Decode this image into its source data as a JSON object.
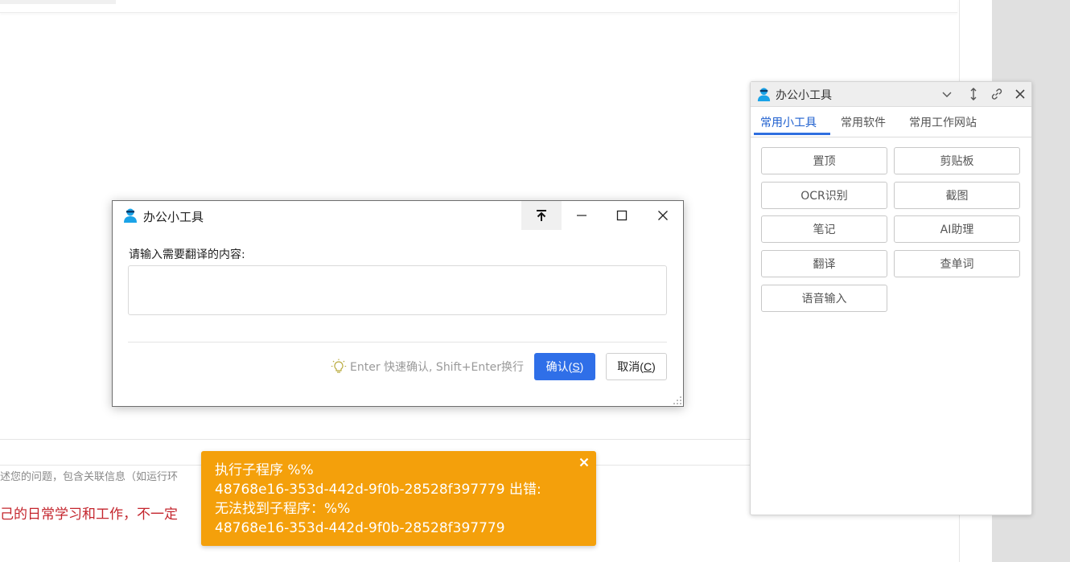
{
  "background": {
    "description_placeholder": "述您的问题，包含关联信息（如运行环",
    "red_note": "己的日常学习和工作，不一定"
  },
  "panel": {
    "title": "办公小工具",
    "tabs": [
      {
        "label": "常用小工具",
        "active": true
      },
      {
        "label": "常用软件",
        "active": false
      },
      {
        "label": "常用工作网站",
        "active": false
      }
    ],
    "tools": [
      "置顶",
      "剪贴板",
      "OCR识别",
      "截图",
      "笔记",
      "AI助理",
      "翻译",
      "查单词",
      "语音输入"
    ],
    "icons": [
      "chevron-down-icon",
      "resize-vertical-icon",
      "link-icon",
      "close-icon"
    ]
  },
  "dialog": {
    "title": "办公小工具",
    "prompt_label": "请输入需要翻译的内容:",
    "input_value": "",
    "hint": "Enter 快速确认, Shift+Enter换行",
    "confirm_text": "确认(",
    "confirm_key": "S",
    "cancel_text": "取消(",
    "cancel_key": "C",
    "close_paren": ")",
    "icons": [
      "pin-top-icon",
      "minimize-icon",
      "maximize-icon",
      "close-icon",
      "lightbulb-icon"
    ]
  },
  "toast": {
    "message": "执行子程序 %%\n48768e16-353d-442d-9f0b-28528f397779 出错:\n无法找到子程序：%%\n48768e16-353d-442d-9f0b-28528f397779"
  },
  "colors": {
    "accent": "#2f6fe8",
    "toast_bg": "#f4a00b",
    "red_text": "#c4262e",
    "logo": "#1aa3e8"
  }
}
